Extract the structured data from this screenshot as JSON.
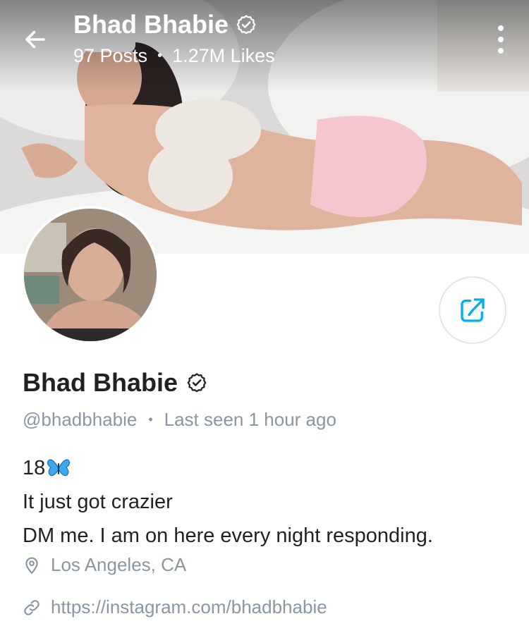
{
  "header": {
    "name": "Bhad Bhabie",
    "posts": "97 Posts",
    "likes": "1.27M Likes",
    "separator": "•"
  },
  "profile": {
    "name": "Bhad Bhabie",
    "handle": "@bhadbhabie",
    "separator": "•",
    "last_seen": "Last seen 1 hour ago",
    "bio": [
      "18",
      "It just got crazier",
      "DM me. I am on here every night responding."
    ],
    "location": "Los Angeles, CA",
    "link": "https://instagram.com/bhadbhabie"
  },
  "icons": {
    "back": "arrow-left-icon",
    "verified": "verified-badge-icon",
    "more": "more-vertical-icon",
    "share": "share-icon",
    "butterfly": "butterfly-icon",
    "location": "map-pin-icon",
    "link": "link-icon"
  },
  "colors": {
    "accent": "#00aff0",
    "muted_text": "#8a96a3",
    "primary_text": "#1f2225",
    "border": "#e3e6e8"
  }
}
